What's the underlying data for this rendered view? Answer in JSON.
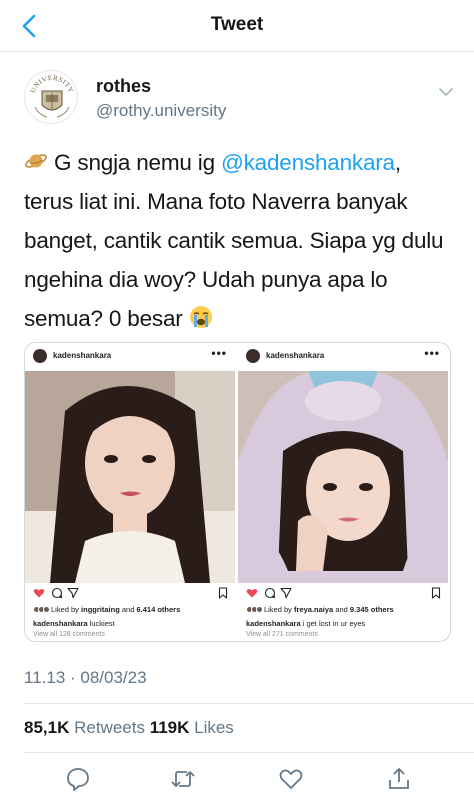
{
  "nav": {
    "title": "Tweet",
    "back_icon": "chevron-left-icon",
    "accent": "#1da1f2"
  },
  "author": {
    "display_name": "rothes",
    "handle": "@rothy.university",
    "avatar_text": "UNIVERSITY"
  },
  "tweet": {
    "emoji_lead": "ringed-planet-emoji",
    "text_1": " G sngja nemu ig ",
    "mention": "@kadenshankara",
    "text_2": ", terus liat ini. Mana foto Naverra banyak banget, cantik cantik semua. Siapa yg dulu ngehina dia woy? Udah punya apa lo semua? 0 besar ",
    "emoji_trail": "loudly-crying-face-emoji"
  },
  "media": {
    "posts": [
      {
        "username": "kadenshankara",
        "liked_by_prefix": "Liked by ",
        "liked_by_user": "inggritaing",
        "liked_by_mid": " and ",
        "liked_by_count": "6.414 others",
        "caption_user": "kadenshankara",
        "caption_text": " luckiest",
        "comments": "View all 128 comments"
      },
      {
        "username": "kadenshankara",
        "liked_by_prefix": "Liked by ",
        "liked_by_user": "freya.naiya",
        "liked_by_mid": " and ",
        "liked_by_count": "9.345 others",
        "caption_user": "kadenshankara",
        "caption_text": " i get lost in ur eyes",
        "comments": "View all 271 comments"
      }
    ]
  },
  "timestamp": "11.13 · 08/03/23",
  "stats": {
    "retweets_count": "85,1K",
    "retweets_label": " Retweets  ",
    "likes_count": "119K",
    "likes_label": " Likes"
  },
  "actions": [
    "reply-icon",
    "retweet-icon",
    "like-icon",
    "share-icon"
  ]
}
